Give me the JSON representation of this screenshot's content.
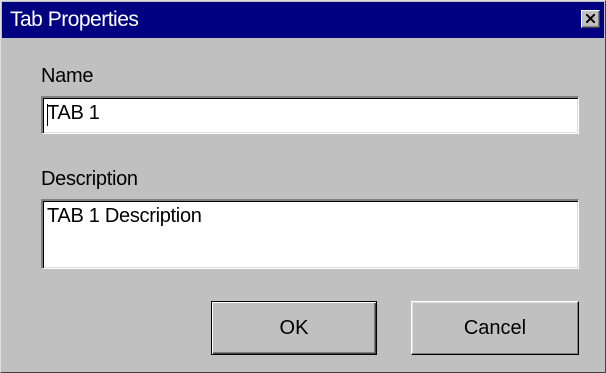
{
  "window": {
    "title": "Tab Properties",
    "close_icon": "close-icon"
  },
  "form": {
    "name_label": "Name",
    "name_value": "TAB 1",
    "description_label": "Description",
    "description_value": "TAB 1 Description"
  },
  "buttons": {
    "ok_label": "OK",
    "cancel_label": "Cancel"
  },
  "colors": {
    "titlebar": "#000080",
    "face": "#c0c0c0"
  }
}
